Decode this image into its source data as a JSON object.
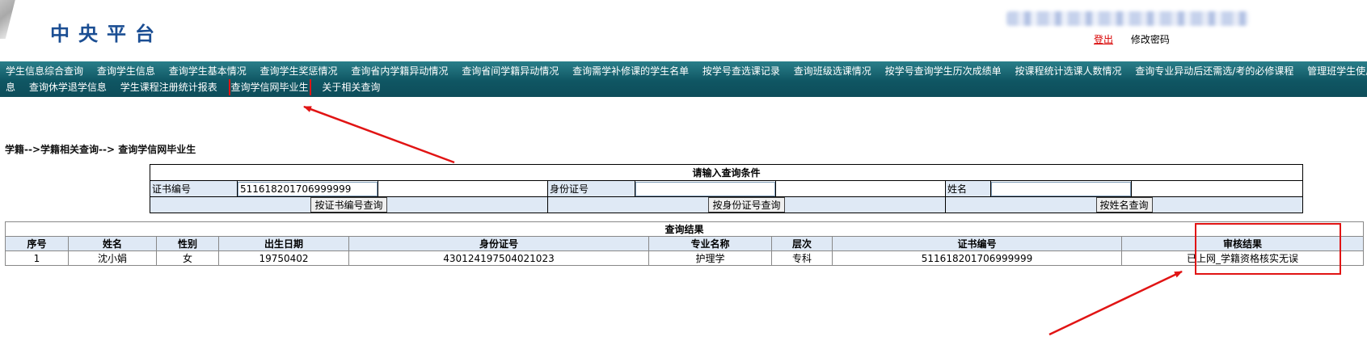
{
  "header": {
    "logo": "中央平台",
    "user_name": "xxx_xxxxxxxx_xxxxx_xxxxxxxx",
    "logout_label": "登出",
    "change_password_label": "修改密码"
  },
  "nav": {
    "row1": [
      "学生信息综合查询",
      "查询学生信息",
      "查询学生基本情况",
      "查询学生奖惩情况",
      "查询省内学籍异动情况",
      "查询省间学籍异动情况",
      "查询需学补修课的学生名单",
      "按学号查选课记录",
      "查询班级选课情况",
      "按学号查询学生历次成绩单",
      "按课程统计选课人数情况",
      "查询专业异动后还需选/考的必修课程",
      "管理班学生使用专业规则统计"
    ],
    "row2": [
      "息",
      "查询休学退学信息",
      "学生课程注册统计报表",
      "查询学信网毕业生",
      "关于相关查询"
    ]
  },
  "breadcrumb": "学籍-->学籍相关查询--> 查询学信网毕业生",
  "query": {
    "title": "请输入查询条件",
    "cert_label": "证书编号",
    "cert_value": "511618201706999999",
    "id_label": "身份证号",
    "id_value": "",
    "name_label": "姓名",
    "name_value": "",
    "btn_cert": "按证书编号查询",
    "btn_id": "按身份证号查询",
    "btn_name": "按姓名查询"
  },
  "results": {
    "title": "查询结果",
    "columns": [
      "序号",
      "姓名",
      "性别",
      "出生日期",
      "身份证号",
      "专业名称",
      "层次",
      "证书编号",
      "审核结果"
    ],
    "rows": [
      [
        "1",
        "沈小娟",
        "女",
        "19750402",
        "430124197504021023",
        "护理学",
        "专科",
        "511618201706999999",
        "已上网_学籍资格核实无误"
      ]
    ]
  },
  "colors": {
    "nav_bg": "#0f5663",
    "label_bg": "#dfe9f5",
    "logo": "#1b4e93",
    "annotation": "#e11414",
    "logout": "#d80000"
  }
}
